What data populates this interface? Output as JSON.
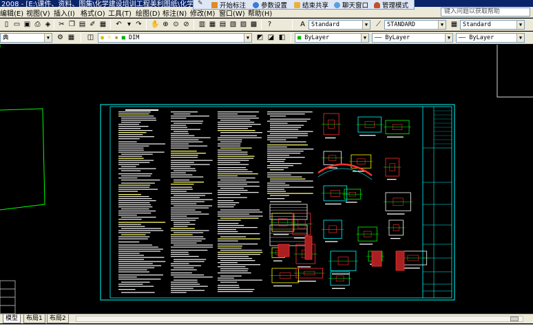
{
  "window": {
    "title": "2008 - [E:\\课件、资料、图集\\化学建设培训工程美利图纸\\化学建设培训工程..."
  },
  "menu": {
    "items": [
      "编辑(E)",
      "视图(V)",
      "插入(I)",
      "格式(O)",
      "工具(T)",
      "绘图(D)",
      "标注(N)",
      "修改(M)",
      "窗口(W)",
      "帮助(H)"
    ],
    "help_placeholder": "键入问题以获取帮助"
  },
  "floatbar": {
    "items": [
      "开始标注",
      "参数设置",
      "结束共享",
      "聊天窗口",
      "管理模式"
    ]
  },
  "toolbar1": {
    "text_style": "Standard",
    "dim_style": "STANDARD",
    "table_style": "Standard"
  },
  "toolbar2": {
    "workspace": "典",
    "layer": "DIM",
    "color": "ByLayer",
    "linetype": "ByLayer",
    "lineweight": "ByLayer"
  },
  "layout_tabs": [
    "模型",
    "布局1",
    "布局2"
  ],
  "colors": {
    "accent": "#0a246a",
    "cad_cyan": "#00ffff",
    "cad_green": "#00ff00",
    "cad_red": "#ff0000"
  }
}
